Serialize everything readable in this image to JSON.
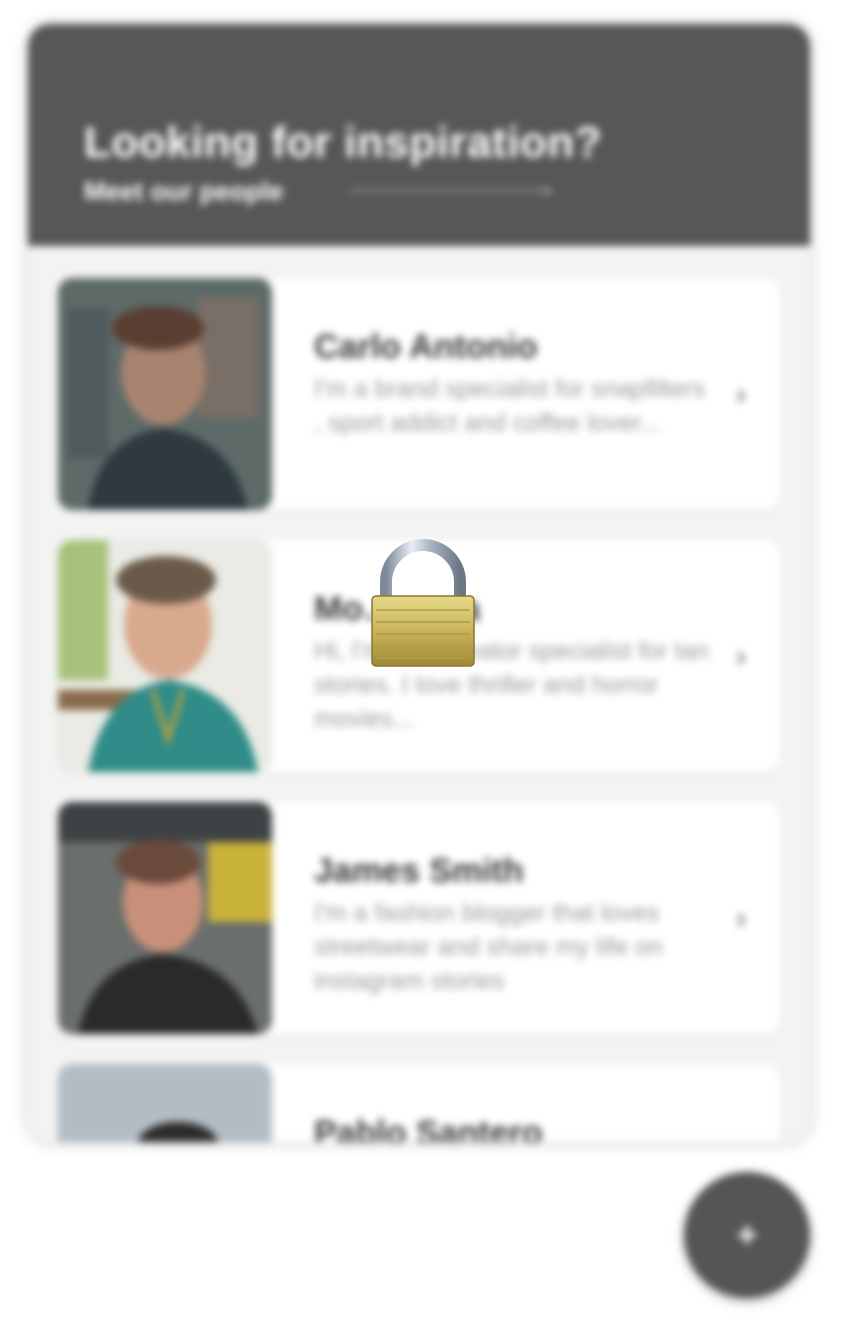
{
  "header": {
    "title": "Looking for inspiration?",
    "subtitle": "Meet our people"
  },
  "cards": [
    {
      "name": "Carlo Antonio",
      "description": "I'm a brand specialist for snapfilters , sport addict and coffee lover..."
    },
    {
      "name": "Mo… …na",
      "description": "Hi, I'm a … creator specialist for tan stories. I love thriller and horror movies..."
    },
    {
      "name": "James Smith",
      "description": "I'm a fashion blogger that loves streetwear and share my life on instagram stories"
    },
    {
      "name": "Pablo Santero",
      "description": ""
    }
  ],
  "fab": {
    "label": "+"
  },
  "overlay": {
    "icon": "lock-icon"
  },
  "colors": {
    "header_bg": "#575757",
    "panel_bg": "#f3f3f3",
    "fab_bg": "#555555",
    "lock_gold": "#c9b45a"
  }
}
